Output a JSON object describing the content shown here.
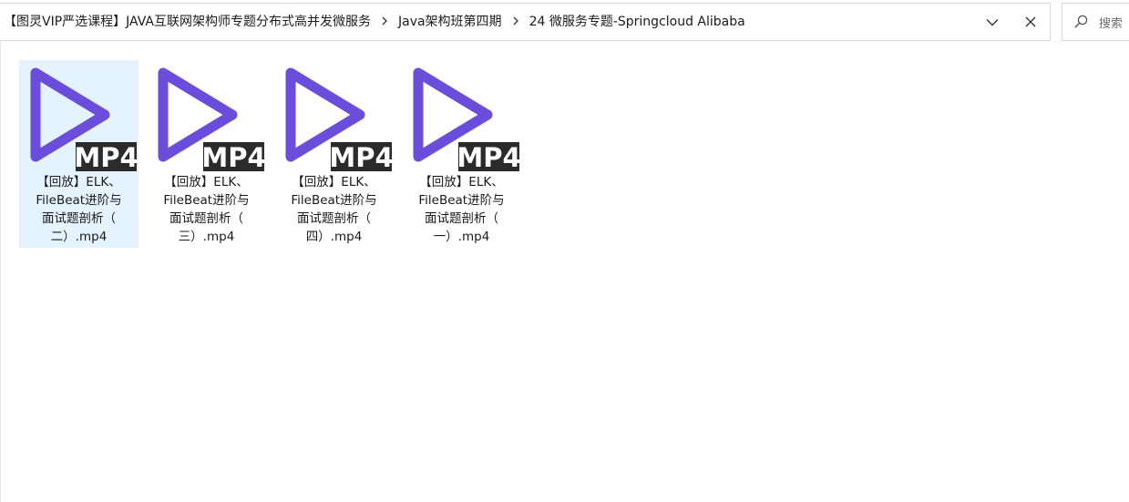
{
  "address_bar": {
    "breadcrumbs": [
      "【图灵VIP严选课程】JAVA互联网架构师专题分布式高并发微服务",
      "Java架构班第四期",
      "24 微服务专题-Springcloud Alibaba"
    ],
    "separator_icon": "chevron-right-icon",
    "dropdown_icon": "chevron-down-icon",
    "close_icon": "close-icon"
  },
  "search": {
    "icon": "search-icon",
    "placeholder": "搜索"
  },
  "files": [
    {
      "name": "【回放】ELK、\nFileBeat进阶与\n面试题剖析（\n二）.mp4",
      "badge": "MP4",
      "selected": true
    },
    {
      "name": "【回放】ELK、\nFileBeat进阶与\n面试题剖析（\n三）.mp4",
      "badge": "MP4",
      "selected": false
    },
    {
      "name": "【回放】ELK、\nFileBeat进阶与\n面试题剖析（\n四）.mp4",
      "badge": "MP4",
      "selected": false
    },
    {
      "name": "【回放】ELK、\nFileBeat进阶与\n面试题剖析（\n一）.mp4",
      "badge": "MP4",
      "selected": false
    }
  ],
  "colors": {
    "play_icon": "#6a4ddb",
    "badge_bg": "#2b2b2b",
    "badge_text": "#ffffff",
    "selection": "#e5f3ff"
  }
}
